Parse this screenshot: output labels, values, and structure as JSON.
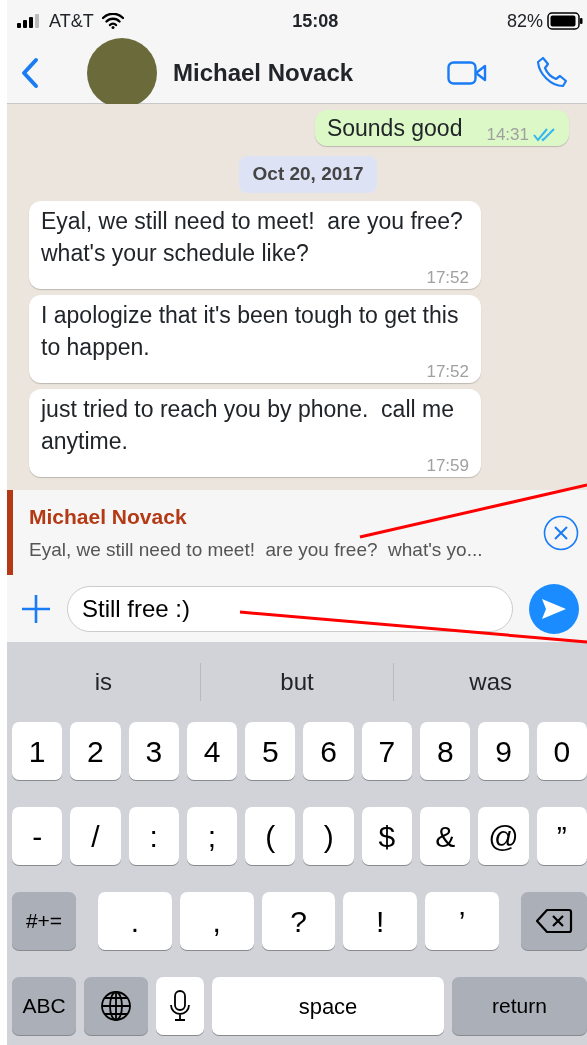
{
  "status_bar": {
    "carrier": "AT&T",
    "time": "15:08",
    "battery": "82%"
  },
  "header": {
    "contact_name": "Michael Novack"
  },
  "messages": [
    {
      "kind": "message",
      "text": "Sounds good",
      "time": "14:31",
      "outgoing": true,
      "read": true
    },
    {
      "kind": "date",
      "text": "Oct 20, 2017"
    },
    {
      "kind": "message",
      "text": "Eyal, we still need to meet!  are you free?  what's your schedule like?",
      "time": "17:52",
      "outgoing": false
    },
    {
      "kind": "message",
      "text": "I apologize that it's been tough to get this to happen.",
      "time": "17:52",
      "outgoing": false
    },
    {
      "kind": "message",
      "text": "just tried to reach you by phone.  call me anytime.",
      "time": "17:59",
      "outgoing": false
    }
  ],
  "reply_preview": {
    "name": "Michael Novack",
    "text": "Eyal, we still need to meet!  are you free?  what's yo..."
  },
  "composer": {
    "value": "Still free :)"
  },
  "keyboard": {
    "suggestions": [
      "is",
      "but",
      "was"
    ],
    "rows": [
      {
        "keys": [
          {
            "kind": "char",
            "label": "1"
          },
          {
            "kind": "char",
            "label": "2"
          },
          {
            "kind": "char",
            "label": "3"
          },
          {
            "kind": "char",
            "label": "4"
          },
          {
            "kind": "char",
            "label": "5"
          },
          {
            "kind": "char",
            "label": "6"
          },
          {
            "kind": "char",
            "label": "7"
          },
          {
            "kind": "char",
            "label": "8"
          },
          {
            "kind": "char",
            "label": "9"
          },
          {
            "kind": "char",
            "label": "0"
          }
        ]
      },
      {
        "keys": [
          {
            "kind": "char",
            "label": "-"
          },
          {
            "kind": "char",
            "label": "/"
          },
          {
            "kind": "char",
            "label": ":"
          },
          {
            "kind": "char",
            "label": ";"
          },
          {
            "kind": "char",
            "label": "("
          },
          {
            "kind": "char",
            "label": ")"
          },
          {
            "kind": "char",
            "label": "$"
          },
          {
            "kind": "char",
            "label": "&"
          },
          {
            "kind": "char",
            "label": "@"
          },
          {
            "kind": "char",
            "label": "”"
          }
        ]
      },
      {
        "keys": [
          {
            "kind": "function",
            "label": "#+="
          },
          {
            "kind": "char",
            "label": "."
          },
          {
            "kind": "char",
            "label": ","
          },
          {
            "kind": "char",
            "label": "?"
          },
          {
            "kind": "char",
            "label": "!"
          },
          {
            "kind": "char",
            "label": "’"
          },
          {
            "kind": "delete"
          }
        ]
      },
      {
        "keys": [
          {
            "kind": "function",
            "label": "ABC"
          },
          {
            "kind": "globe"
          },
          {
            "kind": "mic"
          },
          {
            "kind": "space",
            "label": "space"
          },
          {
            "kind": "function",
            "label": "return"
          }
        ]
      }
    ]
  }
}
